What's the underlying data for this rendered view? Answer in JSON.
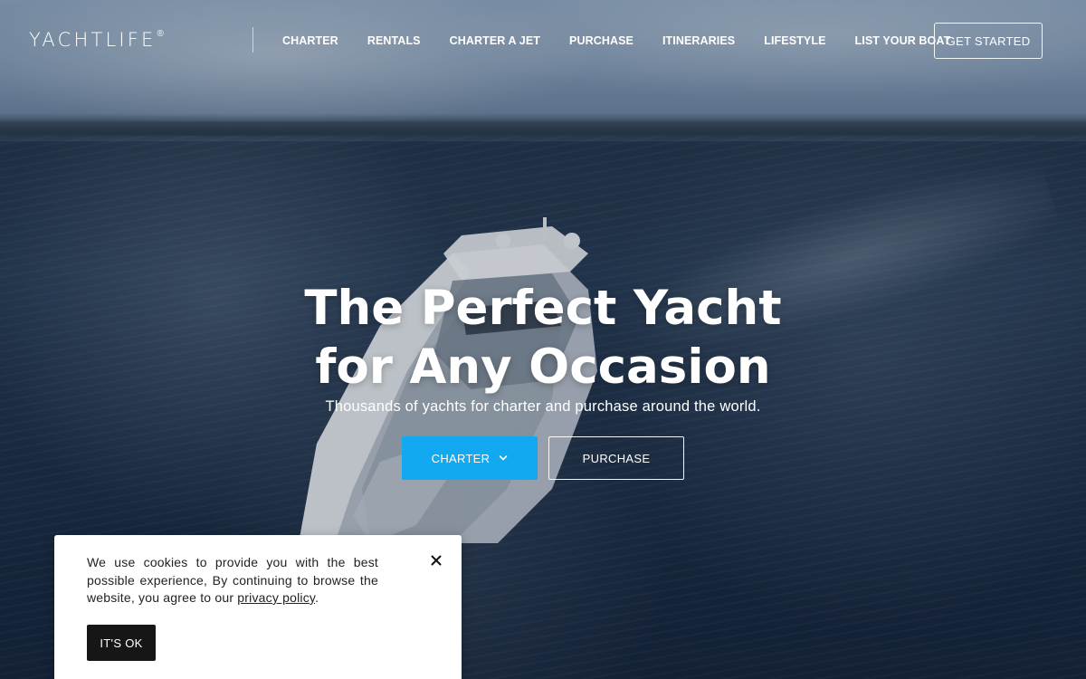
{
  "brand": {
    "logo_text": "YACHTLIFE",
    "logo_mark": "®"
  },
  "nav": {
    "links": [
      {
        "label": "CHARTER"
      },
      {
        "label": "RENTALS"
      },
      {
        "label": "CHARTER A JET"
      },
      {
        "label": "PURCHASE"
      },
      {
        "label": "ITINERARIES"
      },
      {
        "label": "LIFESTYLE"
      },
      {
        "label": "LIST YOUR BOAT"
      }
    ],
    "cta_label": "GET STARTED"
  },
  "hero": {
    "headline_line1": "The Perfect Yacht",
    "headline_line2": "for Any Occasion",
    "subtitle": "Thousands of yachts for charter and purchase around the world.",
    "charter_button": "CHARTER",
    "purchase_button": "PURCHASE",
    "charter_icon": "chevron-down-icon"
  },
  "cookie_banner": {
    "text_before_link": "We use cookies to provide you with the best possible experience, By continuing to browse the website, you agree to our ",
    "link_text": "privacy policy",
    "text_after_link": ".",
    "accept_label": "IT'S OK",
    "close_icon": "close-icon"
  },
  "colors": {
    "accent": "#12a9f0",
    "dark_button": "#161616",
    "text_light": "#ffffff"
  }
}
